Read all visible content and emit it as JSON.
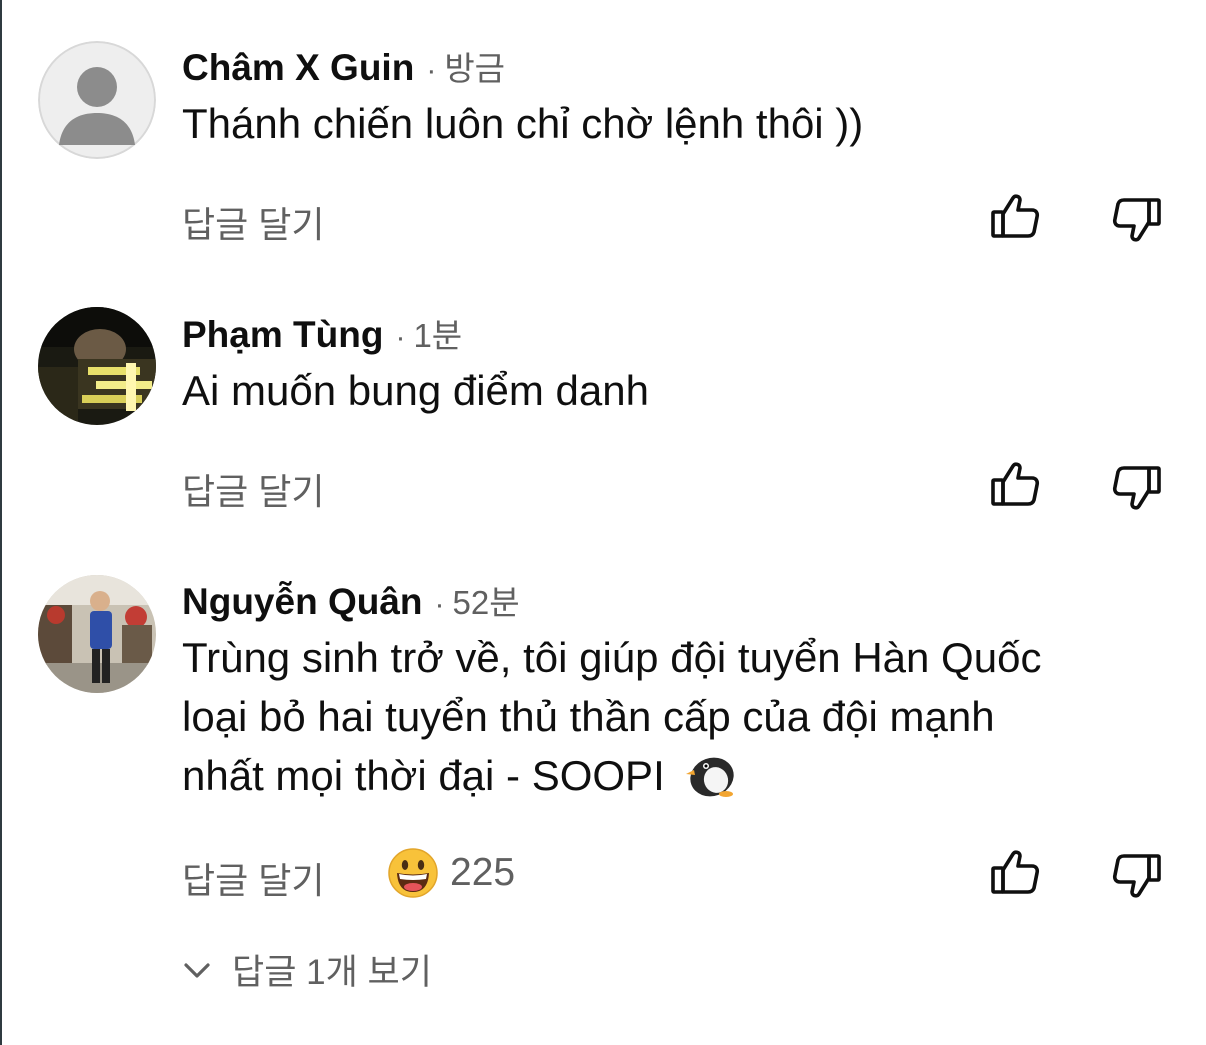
{
  "comments": [
    {
      "author": "Châm X Guin",
      "separator": "·",
      "time": "방금",
      "text_lines": [
        "Thánh chiến luôn chỉ chờ lệnh thôi ))"
      ],
      "reply_label": "답글 달기",
      "avatar": "default-avatar-icon"
    },
    {
      "author": "Phạm Tùng",
      "separator": "·",
      "time": "1분",
      "text_lines": [
        "Ai muốn bung điểm danh"
      ],
      "reply_label": "답글 달기",
      "avatar": "photo-avatar"
    },
    {
      "author": "Nguyễn Quân",
      "separator": "·",
      "time": "52분",
      "text_lines": [
        "Trùng sinh trở về, tôi giúp đội tuyển Hàn Quốc",
        "loại bỏ hai tuyển thủ thần cấp của đội mạnh",
        "nhất mọi thời đại - SOOPI"
      ],
      "text_emoji": "penguin-emoji",
      "reply_label": "답글 달기",
      "reaction": {
        "icon": "grinning-face-emoji",
        "count": "225"
      },
      "avatar": "photo-avatar"
    }
  ],
  "view_replies": {
    "label": "답글 1개 보기",
    "icon": "chevron-down-icon"
  },
  "icons": {
    "like": "thumbs-up-icon",
    "dislike": "thumbs-down-icon"
  },
  "colors": {
    "primary_text": "#0f0f0f",
    "secondary_text": "#606060"
  }
}
